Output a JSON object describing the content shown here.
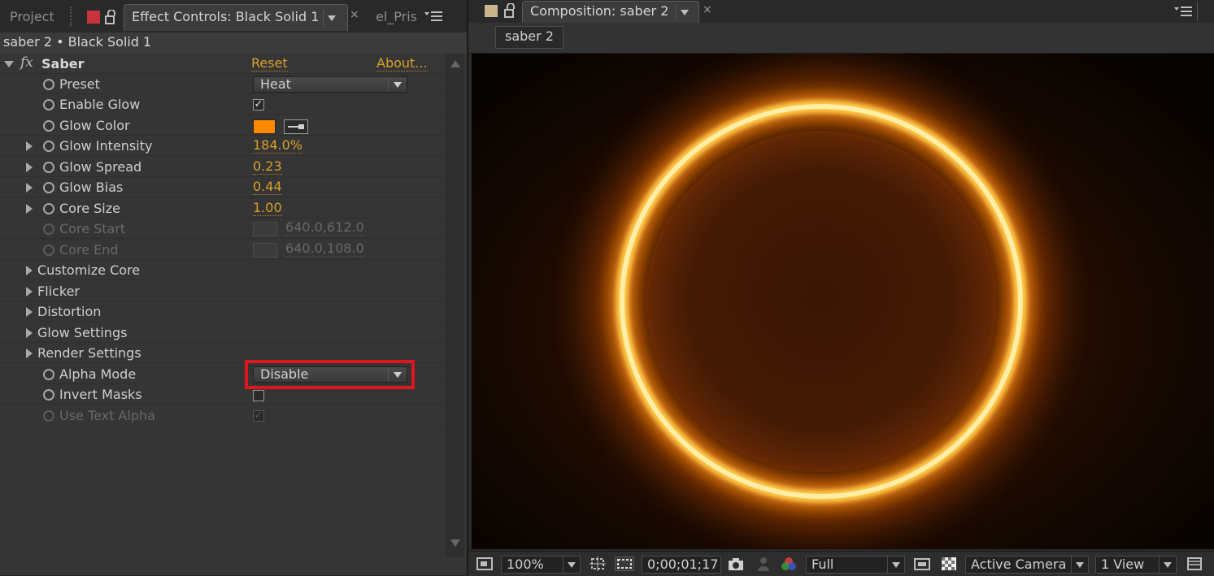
{
  "left_panel": {
    "tabs": {
      "project": "Project",
      "effect_controls": "Effect Controls: Black Solid 1",
      "third": "el_Pris"
    },
    "breadcrumb": "saber 2 • Black Solid 1",
    "effect": {
      "fx": "fx",
      "name": "Saber",
      "reset": "Reset",
      "about": "About..."
    },
    "rows": {
      "preset": {
        "label": "Preset",
        "value": "Heat"
      },
      "enable_glow": {
        "label": "Enable Glow",
        "checked": "✓"
      },
      "glow_color": {
        "label": "Glow Color",
        "color": "#ff8a00"
      },
      "glow_intensity": {
        "label": "Glow Intensity",
        "value": "184.0%"
      },
      "glow_spread": {
        "label": "Glow Spread",
        "value": "0.23"
      },
      "glow_bias": {
        "label": "Glow Bias",
        "value": "0.44"
      },
      "core_size": {
        "label": "Core Size",
        "value": "1.00"
      },
      "core_start": {
        "label": "Core Start",
        "value": "640.0,612.0"
      },
      "core_end": {
        "label": "Core End",
        "value": "640.0,108.0"
      },
      "customize_core": {
        "label": "Customize Core"
      },
      "flicker": {
        "label": "Flicker"
      },
      "distortion": {
        "label": "Distortion"
      },
      "glow_settings": {
        "label": "Glow Settings"
      },
      "render_settings": {
        "label": "Render Settings"
      },
      "alpha_mode": {
        "label": "Alpha Mode",
        "value": "Disable"
      },
      "invert_masks": {
        "label": "Invert Masks",
        "checked": ""
      },
      "use_text_alpha": {
        "label": "Use Text Alpha",
        "checked": "✓"
      }
    }
  },
  "right_panel": {
    "tab": "Composition: saber 2",
    "comp_button": "saber 2",
    "footer": {
      "zoom": "100%",
      "timecode": "0;00;01;17",
      "resolution": "Full",
      "camera": "Active Camera",
      "views": "1 View"
    }
  },
  "colors": {
    "accent_value": "#d9a02c",
    "highlight_box": "#e0151f",
    "glow_color": "#ff8a00"
  }
}
